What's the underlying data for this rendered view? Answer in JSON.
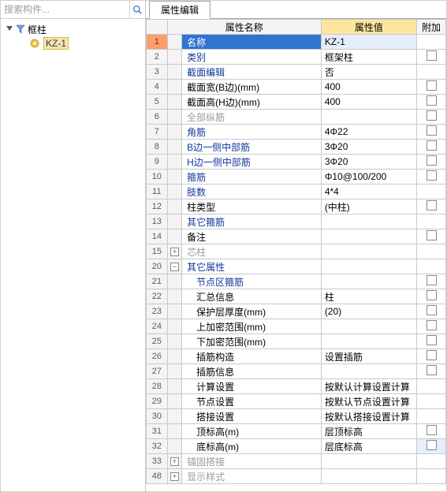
{
  "left": {
    "search_placeholder": "搜索构件...",
    "root_label": "框柱",
    "child_label": "KZ-1"
  },
  "tab_label": "属性编辑",
  "headers": {
    "name": "属性名称",
    "value": "属性值",
    "extra": "附加"
  },
  "rows": [
    {
      "n": "1",
      "name": "名称",
      "val": "KZ-1",
      "sel": true,
      "cb": false
    },
    {
      "n": "2",
      "name": "类别",
      "val": "框架柱",
      "blue": true,
      "cb": true
    },
    {
      "n": "3",
      "name": "截面编辑",
      "val": "否",
      "blue": true,
      "cb": false
    },
    {
      "n": "4",
      "name": "截面宽(B边)(mm)",
      "val": "400",
      "cb": true
    },
    {
      "n": "5",
      "name": "截面高(H边)(mm)",
      "val": "400",
      "cb": true
    },
    {
      "n": "6",
      "name": "全部纵筋",
      "val": "",
      "grey": true,
      "cb": true
    },
    {
      "n": "7",
      "name": "角筋",
      "val": "4Φ22",
      "blue": true,
      "cb": true
    },
    {
      "n": "8",
      "name": "B边一侧中部筋",
      "val": "3Φ20",
      "blue": true,
      "cb": true
    },
    {
      "n": "9",
      "name": "H边一侧中部筋",
      "val": "3Φ20",
      "blue": true,
      "cb": true
    },
    {
      "n": "10",
      "name": "箍筋",
      "val": "Φ10@100/200",
      "blue": true,
      "cb": true
    },
    {
      "n": "11",
      "name": "肢数",
      "val": "4*4",
      "blue": true,
      "cb": false
    },
    {
      "n": "12",
      "name": "柱类型",
      "val": "(中柱)",
      "cb": true
    },
    {
      "n": "13",
      "name": "其它箍筋",
      "val": "",
      "blue": true,
      "cb": false
    },
    {
      "n": "14",
      "name": "备注",
      "val": "",
      "cb": true
    },
    {
      "n": "15",
      "name": "芯柱",
      "val": "",
      "grey": true,
      "exp": "+",
      "noind": true
    },
    {
      "n": "20",
      "name": "其它属性",
      "val": "",
      "blue": true,
      "exp": "-",
      "noind": true
    },
    {
      "n": "21",
      "name": "节点区箍筋",
      "val": "",
      "blue": true,
      "ind": true,
      "cb": true
    },
    {
      "n": "22",
      "name": "汇总信息",
      "val": "柱",
      "ind": true,
      "cb": true
    },
    {
      "n": "23",
      "name": "保护层厚度(mm)",
      "val": "(20)",
      "ind": true,
      "cb": true
    },
    {
      "n": "24",
      "name": "上加密范围(mm)",
      "val": "",
      "ind": true,
      "cb": true
    },
    {
      "n": "25",
      "name": "下加密范围(mm)",
      "val": "",
      "ind": true,
      "cb": true
    },
    {
      "n": "26",
      "name": "插筋构造",
      "val": "设置插筋",
      "ind": true,
      "cb": true
    },
    {
      "n": "27",
      "name": "插筋信息",
      "val": "",
      "ind": true,
      "cb": true
    },
    {
      "n": "28",
      "name": "计算设置",
      "val": "按默认计算设置计算",
      "ind": true,
      "cb": false
    },
    {
      "n": "29",
      "name": "节点设置",
      "val": "按默认节点设置计算",
      "ind": true,
      "cb": false
    },
    {
      "n": "30",
      "name": "搭接设置",
      "val": "按默认搭接设置计算",
      "ind": true,
      "cb": false
    },
    {
      "n": "31",
      "name": "顶标高(m)",
      "val": "层顶标高",
      "ind": true,
      "cb": true,
      "hl": true
    },
    {
      "n": "32",
      "name": "底标高(m)",
      "val": "层底标高",
      "ind": true,
      "cb": true,
      "hl": true,
      "extsel": true
    },
    {
      "n": "33",
      "name": "锚固搭接",
      "val": "",
      "grey": true,
      "exp": "+",
      "noind": true
    },
    {
      "n": "48",
      "name": "显示样式",
      "val": "",
      "grey": true,
      "exp": "+",
      "noind": true
    }
  ]
}
